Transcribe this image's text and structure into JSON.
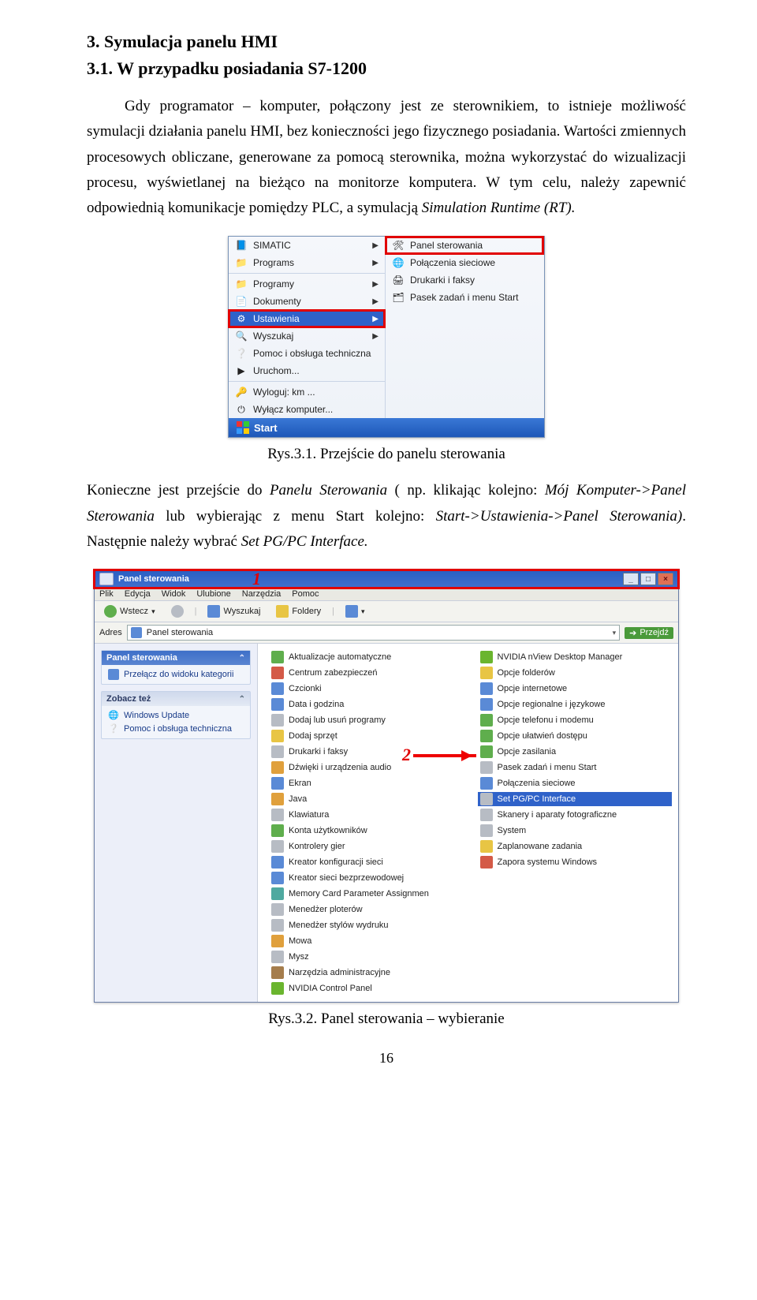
{
  "section_title": "3. Symulacja panelu HMI",
  "subsection_title": "3.1. W przypadku posiadania S7-1200",
  "para1_part1": "Gdy programator – komputer, połączony jest ze sterownikiem, to istnieje możliwość symulacji działania panelu HMI, bez konieczności jego fizycznego posiadania. Wartości zmiennych procesowych obliczane, generowane za pomocą sterownika, można wykorzystać do wizualizacji procesu, wyświetlanej na bieżąco na monitorze komputera. W tym celu, należy zapewnić odpowiednią komunikacje pomiędzy PLC, a symulacją ",
  "para1_italic": "Simulation Runtime (RT).",
  "fig1_caption": "Rys.3.1. Przejście do panelu sterowania",
  "para2_part1": "Konieczne jest przejście do ",
  "para2_ital1": "Panelu Sterowania",
  "para2_part2": " ( np. klikając kolejno: ",
  "para2_ital2": "Mój Komputer->Panel Sterowania",
  "para2_part3": " lub wybierając z menu Start kolejno: ",
  "para2_ital3": "Start->Ustawienia->Panel Sterowania)",
  "para2_part4": ". Następnie należy wybrać ",
  "para2_ital4": "Set PG/PC Interface.",
  "fig2_caption": "Rys.3.2. Panel sterowania – wybieranie",
  "page_number": "16",
  "fig1": {
    "left": [
      {
        "ico": "📘",
        "label": "SIMATIC",
        "arrow": true
      },
      {
        "ico": "📁",
        "label": "Programs",
        "arrow": true
      },
      {
        "sep": true
      },
      {
        "ico": "📁",
        "label": "Programy",
        "arrow": true
      },
      {
        "ico": "📄",
        "label": "Dokumenty",
        "arrow": true
      },
      {
        "ico": "⚙",
        "label": "Ustawienia",
        "arrow": true,
        "hover": true,
        "red": true
      },
      {
        "ico": "🔍",
        "label": "Wyszukaj",
        "arrow": true
      },
      {
        "ico": "❔",
        "label": "Pomoc i obsługa techniczna"
      },
      {
        "ico": "▶",
        "label": "Uruchom..."
      },
      {
        "sep": true
      },
      {
        "ico": "🔑",
        "label": "Wyloguj: km ..."
      },
      {
        "ico": "⏻",
        "label": "Wyłącz komputer..."
      }
    ],
    "right": [
      {
        "ico": "🛠",
        "label": "Panel sterowania",
        "red": true
      },
      {
        "ico": "🌐",
        "label": "Połączenia sieciowe"
      },
      {
        "ico": "🖨",
        "label": "Drukarki i faksy"
      },
      {
        "ico": "🗂",
        "label": "Pasek zadań i menu Start"
      }
    ],
    "start": "Start"
  },
  "fig2": {
    "title": "Panel sterowania",
    "num1": "1",
    "num2": "2",
    "menus": [
      "Plik",
      "Edycja",
      "Widok",
      "Ulubione",
      "Narzędzia",
      "Pomoc"
    ],
    "tools": {
      "back": "Wstecz",
      "search": "Wyszukaj",
      "folders": "Foldery"
    },
    "addr_label": "Adres",
    "addr_value": "Panel sterowania",
    "go": "Przejdź",
    "side_panel_hd": "Panel sterowania",
    "side_panel_link": "Przełącz do widoku kategorii",
    "side_see_hd": "Zobacz też",
    "side_see": [
      {
        "ico": "🌐",
        "label": "Windows Update"
      },
      {
        "ico": "❔",
        "label": "Pomoc i obsługa techniczna"
      }
    ],
    "col1": [
      {
        "ic": "ic-green",
        "label": "Aktualizacje automatyczne"
      },
      {
        "ic": "ic-red",
        "label": "Centrum zabezpieczeń"
      },
      {
        "ic": "ic-blue",
        "label": "Czcionki"
      },
      {
        "ic": "ic-blue",
        "label": "Data i godzina"
      },
      {
        "ic": "ic-grey",
        "label": "Dodaj lub usuń programy"
      },
      {
        "ic": "ic-yellow",
        "label": "Dodaj sprzęt"
      },
      {
        "ic": "ic-grey",
        "label": "Drukarki i faksy"
      },
      {
        "ic": "ic-orange",
        "label": "Dźwięki i urządzenia audio"
      },
      {
        "ic": "ic-blue",
        "label": "Ekran"
      },
      {
        "ic": "ic-orange",
        "label": "Java"
      },
      {
        "ic": "ic-grey",
        "label": "Klawiatura"
      },
      {
        "ic": "ic-green",
        "label": "Konta użytkowników"
      },
      {
        "ic": "ic-grey",
        "label": "Kontrolery gier"
      },
      {
        "ic": "ic-blue",
        "label": "Kreator konfiguracji sieci"
      },
      {
        "ic": "ic-blue",
        "label": "Kreator sieci bezprzewodowej"
      },
      {
        "ic": "ic-teal",
        "label": "Memory Card Parameter Assignmen"
      },
      {
        "ic": "ic-grey",
        "label": "Menedżer ploterów"
      },
      {
        "ic": "ic-grey",
        "label": "Menedżer stylów wydruku"
      },
      {
        "ic": "ic-orange",
        "label": "Mowa"
      },
      {
        "ic": "ic-grey",
        "label": "Mysz"
      },
      {
        "ic": "ic-brown",
        "label": "Narzędzia administracyjne"
      },
      {
        "ic": "ic-nv",
        "label": "NVIDIA Control Panel"
      }
    ],
    "col2": [
      {
        "ic": "ic-nv",
        "label": "NVIDIA nView Desktop Manager"
      },
      {
        "ic": "ic-yellow",
        "label": "Opcje folderów"
      },
      {
        "ic": "ic-blue",
        "label": "Opcje internetowe"
      },
      {
        "ic": "ic-blue",
        "label": "Opcje regionalne i językowe"
      },
      {
        "ic": "ic-green",
        "label": "Opcje telefonu i modemu"
      },
      {
        "ic": "ic-green",
        "label": "Opcje ułatwień dostępu"
      },
      {
        "ic": "ic-green",
        "label": "Opcje zasilania"
      },
      {
        "ic": "ic-grey",
        "label": "Pasek zadań i menu Start"
      },
      {
        "ic": "ic-blue",
        "label": "Połączenia sieciowe"
      },
      {
        "ic": "ic-grey",
        "label": "Set PG/PC Interface",
        "sel": true
      },
      {
        "ic": "ic-grey",
        "label": "Skanery i aparaty fotograficzne"
      },
      {
        "ic": "ic-grey",
        "label": "System"
      },
      {
        "ic": "ic-yellow",
        "label": "Zaplanowane zadania"
      },
      {
        "ic": "ic-red",
        "label": "Zapora systemu Windows"
      }
    ]
  }
}
